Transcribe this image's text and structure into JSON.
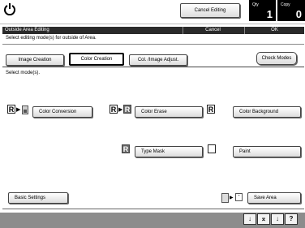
{
  "header": {
    "power_icon": "power-icon",
    "cancel_editing_label": "Cancel Editing",
    "qty_label": "Qty",
    "qty_value": "1",
    "copy_label": "Copy",
    "copy_value": "0"
  },
  "titlebar": {
    "title": "Outside Area Editing",
    "cancel_label": "Cancel",
    "ok_label": "OK"
  },
  "instruction": "Select editing mode(s) for outside of Area.",
  "tabs": [
    {
      "label": "Image Creation"
    },
    {
      "label": "Color Creation",
      "selected": true
    },
    {
      "label": "Col. /Image Adjust."
    }
  ],
  "check_modes_label": "Check Modes",
  "select_modes_label": "Select mode(s).",
  "modes": {
    "color_conversion": "Color Conversion",
    "color_erase": "Color Erase",
    "color_background": "Color Background",
    "type_mask": "Type Mask",
    "paint": "Paint",
    "r_glyph": "R"
  },
  "footer": {
    "basic_settings": "Basic Settings",
    "save_area": "Save Area"
  },
  "colors": {
    "titlebar": "#2a2a2a",
    "footer": "#8c8c8c",
    "button_top": "#ffffff",
    "button_bottom": "#dcdcdc"
  }
}
